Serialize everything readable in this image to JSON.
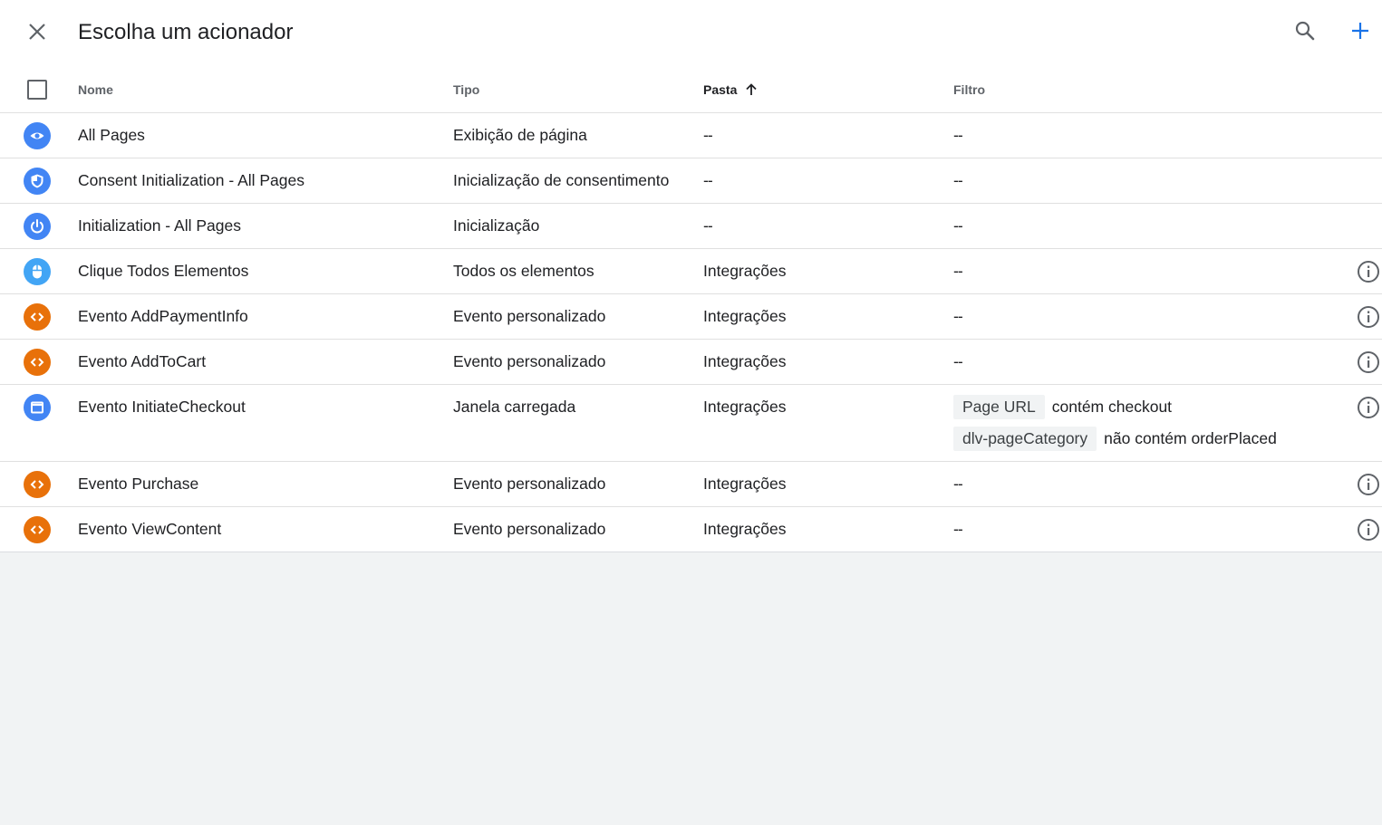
{
  "header": {
    "title": "Escolha um acionador",
    "close_icon": "close-icon",
    "search_icon": "search-icon",
    "add_icon": "add-icon",
    "accent_color": "#1a73e8"
  },
  "table": {
    "columns": {
      "name": "Nome",
      "type": "Tipo",
      "folder": "Pasta",
      "filter": "Filtro"
    },
    "sort_column": "Pasta",
    "sort_direction": "ascending",
    "rows": [
      {
        "icon": "eye-icon",
        "icon_color": "#4285f4",
        "name": "All Pages",
        "type": "Exibição de página",
        "folder": "--",
        "filter": "--",
        "info": false
      },
      {
        "icon": "shield-icon",
        "icon_color": "#4285f4",
        "name": "Consent Initialization - All Pages",
        "type": "Inicialização de consentimento",
        "folder": "--",
        "filter": "--",
        "info": false
      },
      {
        "icon": "power-icon",
        "icon_color": "#4285f4",
        "name": "Initialization - All Pages",
        "type": "Inicialização",
        "folder": "--",
        "filter": "--",
        "info": false
      },
      {
        "icon": "mouse-icon",
        "icon_color": "#42a5f5",
        "name": "Clique Todos Elementos",
        "type": "Todos os elementos",
        "folder": "Integrações",
        "filter": "--",
        "info": true
      },
      {
        "icon": "code-icon",
        "icon_color": "#e8710a",
        "name": "Evento AddPaymentInfo",
        "type": "Evento personalizado",
        "folder": "Integrações",
        "filter": "--",
        "info": true
      },
      {
        "icon": "code-icon",
        "icon_color": "#e8710a",
        "name": "Evento AddToCart",
        "type": "Evento personalizado",
        "folder": "Integrações",
        "filter": "--",
        "info": true
      },
      {
        "icon": "window-icon",
        "icon_color": "#4285f4",
        "name": "Evento InitiateCheckout",
        "type": "Janela carregada",
        "folder": "Integrações",
        "info": true,
        "filters": [
          {
            "variable": "Page URL",
            "condition": "contém checkout"
          },
          {
            "variable": "dlv-pageCategory",
            "condition": "não contém orderPlaced"
          }
        ]
      },
      {
        "icon": "code-icon",
        "icon_color": "#e8710a",
        "name": "Evento Purchase",
        "type": "Evento personalizado",
        "folder": "Integrações",
        "filter": "--",
        "info": true
      },
      {
        "icon": "code-icon",
        "icon_color": "#e8710a",
        "name": "Evento ViewContent",
        "type": "Evento personalizado",
        "folder": "Integrações",
        "filter": "--",
        "info": true
      }
    ]
  }
}
